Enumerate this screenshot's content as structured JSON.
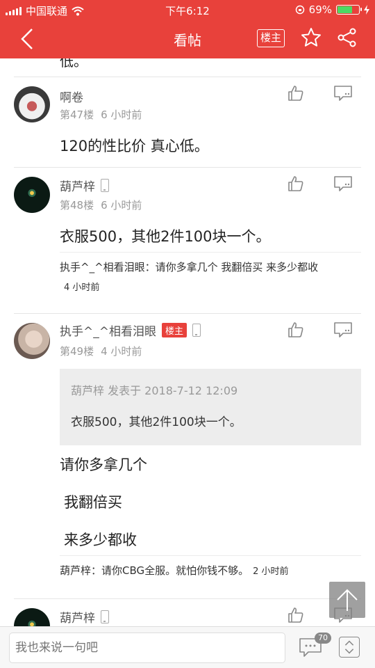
{
  "status_bar": {
    "carrier": "中国联通",
    "time": "下午6:12",
    "battery_pct_label": "69%",
    "battery_level": 0.69
  },
  "nav": {
    "title": "看帖",
    "louzhu_button": "楼主"
  },
  "clipped_text": "低。",
  "posts": [
    {
      "username": "啊卷",
      "floor": "第47楼",
      "time": "6 小时前",
      "body": "120的性比价 真心低。"
    },
    {
      "username": "葫芦梓",
      "floor": "第48楼",
      "time": "6 小时前",
      "body": "衣服500，其他2件100块一个。",
      "sub_reply": {
        "text": "执手^_^相看泪眼：请你多拿几个 我翻倍买 来多少都收",
        "time": "4 小时前"
      }
    },
    {
      "username": "执手^_^相看泪眼",
      "badge": "楼主",
      "floor": "第49楼",
      "time": "4 小时前",
      "quote": {
        "head": "葫芦梓 发表于 2018-7-12 12:09",
        "body": "衣服500，其他2件100块一个。"
      },
      "lines": [
        "请你多拿几个",
        "我翻倍买",
        "来多少都收"
      ],
      "sub_reply": {
        "text": "葫芦梓：请你CBG全服。就怕你钱不够。",
        "time": "2 小时前"
      }
    },
    {
      "username": "葫芦梓"
    }
  ],
  "bottom": {
    "input_placeholder": "我也来说一句吧",
    "comment_count": "70"
  },
  "colors": {
    "accent": "#e8413b",
    "battery": "#4cd964"
  }
}
